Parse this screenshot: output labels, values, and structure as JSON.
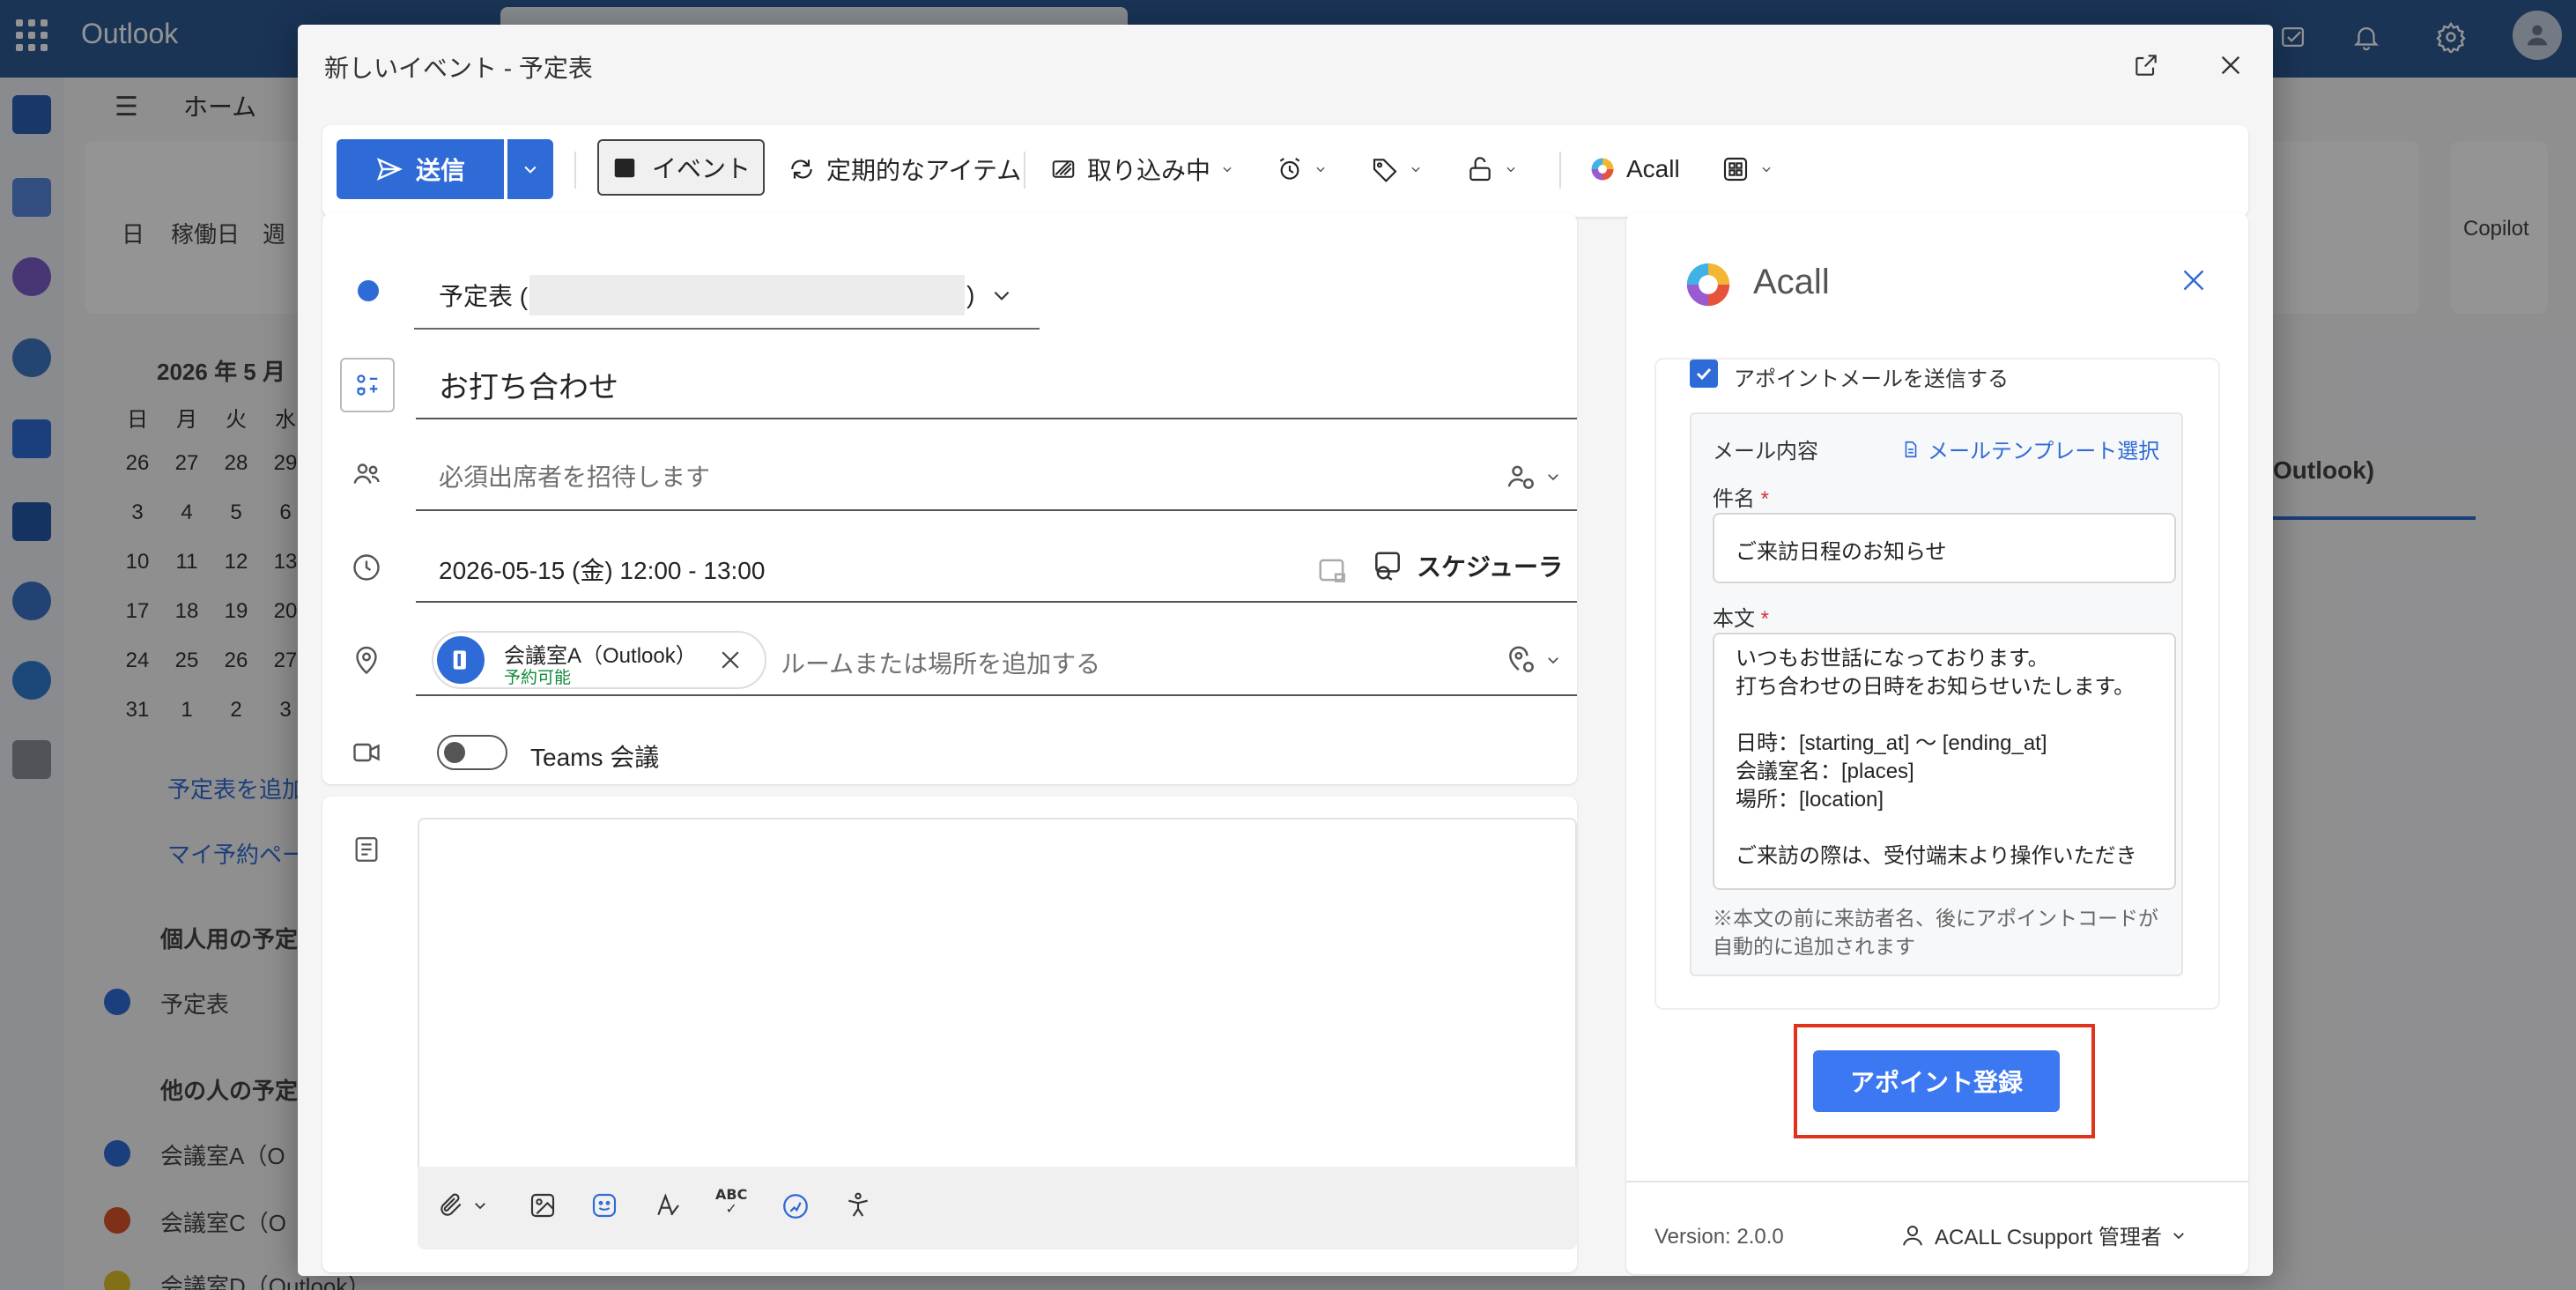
{
  "app": {
    "name": "Outlook"
  },
  "background": {
    "nav": {
      "home": "ホーム"
    },
    "views": [
      "日",
      "稼働日",
      "週"
    ],
    "copilot": "Copilot",
    "month_title": "2026 年 5 月",
    "weekdays": [
      "日",
      "月",
      "火",
      "水"
    ],
    "weeks": [
      [
        "26",
        "27",
        "28",
        "29"
      ],
      [
        "3",
        "4",
        "5",
        "6"
      ],
      [
        "10",
        "11",
        "12",
        "13"
      ],
      [
        "17",
        "18",
        "19",
        "20"
      ],
      [
        "24",
        "25",
        "26",
        "27"
      ],
      [
        "31",
        "1",
        "2",
        "3"
      ]
    ],
    "add_calendar": "予定表を追加",
    "my_booking": "マイ予約ペー",
    "personal_section": "個人用の予定",
    "personal_calendar": "予定表",
    "others_section": "他の人の予定",
    "others_calendars": [
      {
        "label": "会議室A（O",
        "color": "#2f6bd6"
      },
      {
        "label": "会議室C（O",
        "color": "#d9532c"
      },
      {
        "label": "会議室D（Outlook）",
        "color": "#e0c22c"
      }
    ],
    "right_peek": "Outlook)"
  },
  "dialog": {
    "title": "新しいイベント - 予定表",
    "toolbar": {
      "send": "送信",
      "event": "イベント",
      "recurring": "定期的なアイテム",
      "busy": "取り込み中",
      "acall": "Acall"
    },
    "form": {
      "calendar_label": "予定表 (",
      "calendar_suffix": ")",
      "title": "お打ち合わせ",
      "attendees_placeholder": "必須出席者を招待します",
      "datetime": "2026-05-15 (金) 12:00 - 13:00",
      "scheduler": "スケジューラ",
      "room_name": "会議室A（Outlook）",
      "room_status": "予約可能",
      "location_placeholder": "ルームまたは場所を追加する",
      "teams": "Teams 会議"
    }
  },
  "acall_panel": {
    "title": "Acall",
    "send_mail_checkbox": "アポイントメールを送信する",
    "mail_content_label": "メール内容",
    "template_link": "メールテンプレート選択",
    "subject_label": "件名",
    "subject_value": "ご来訪日程のお知らせ",
    "body_label": "本文",
    "body_lines": [
      "いつもお世話になっております。",
      "打ち合わせの日時をお知らせいたします。",
      "",
      "日時：[starting_at] 〜 [ending_at]",
      "会議室名：[places]",
      "場所：[location]",
      "",
      "ご来訪の際は、受付端末より操作いただき"
    ],
    "note": "※本文の前に来訪者名、後にアポイントコードが自動的に追加されます",
    "register_button": "アポイント登録",
    "version": "Version: 2.0.0",
    "user": "ACALL Csupport 管理者"
  },
  "colors": {
    "brand_blue": "#2f6bd6",
    "topbar": "#2e5a94",
    "accent_button": "#3b78f2",
    "highlight": "#e0331b"
  }
}
